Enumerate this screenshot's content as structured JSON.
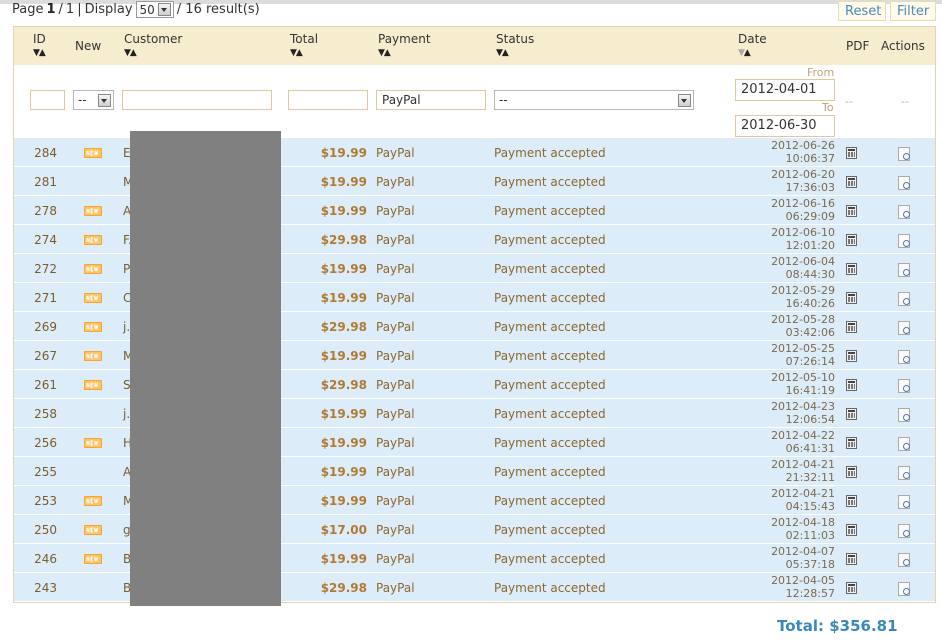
{
  "pagination": {
    "page_label": "Page",
    "current": "1",
    "sep": "/",
    "total_pages": "1",
    "pipe": "|",
    "display_label": "Display",
    "per_page": "50",
    "results": "/ 16 result(s)"
  },
  "buttons": {
    "reset": "Reset",
    "filter": "Filter"
  },
  "columns": {
    "id": "ID",
    "new": "New",
    "customer": "Customer",
    "total": "Total",
    "payment": "Payment",
    "status": "Status",
    "date": "Date",
    "pdf": "PDF",
    "actions": "Actions"
  },
  "filters": {
    "new_value": "--",
    "payment_value": "PayPal",
    "status_value": "--",
    "from_label": "From",
    "date_from": "2012-04-01",
    "to_label": "To",
    "date_to": "2012-06-30",
    "pdf_value": "--",
    "actions_value": "--"
  },
  "icons": {
    "new": "new-badge-icon",
    "pdf": "invoice-icon",
    "view": "view-details-icon"
  },
  "rows": [
    {
      "id": "284",
      "is_new": true,
      "customer": "E",
      "total": "$19.99",
      "payment": "PayPal",
      "status": "Payment accepted",
      "date": "2012-06-26",
      "time": "10:06:37"
    },
    {
      "id": "281",
      "is_new": false,
      "customer": "M",
      "total": "$19.99",
      "payment": "PayPal",
      "status": "Payment accepted",
      "date": "2012-06-20",
      "time": "17:36:03"
    },
    {
      "id": "278",
      "is_new": true,
      "customer": "A",
      "total": "$19.99",
      "payment": "PayPal",
      "status": "Payment accepted",
      "date": "2012-06-16",
      "time": "06:29:09"
    },
    {
      "id": "274",
      "is_new": true,
      "customer": "F.",
      "total": "$29.98",
      "payment": "PayPal",
      "status": "Payment accepted",
      "date": "2012-06-10",
      "time": "12:01:20"
    },
    {
      "id": "272",
      "is_new": true,
      "customer": "P",
      "total": "$19.99",
      "payment": "PayPal",
      "status": "Payment accepted",
      "date": "2012-06-04",
      "time": "08:44:30"
    },
    {
      "id": "271",
      "is_new": true,
      "customer": "C",
      "total": "$19.99",
      "payment": "PayPal",
      "status": "Payment accepted",
      "date": "2012-05-29",
      "time": "16:40:26"
    },
    {
      "id": "269",
      "is_new": true,
      "customer": "j.",
      "total": "$29.98",
      "payment": "PayPal",
      "status": "Payment accepted",
      "date": "2012-05-28",
      "time": "03:42:06"
    },
    {
      "id": "267",
      "is_new": true,
      "customer": "M",
      "total": "$19.99",
      "payment": "PayPal",
      "status": "Payment accepted",
      "date": "2012-05-25",
      "time": "07:26:14"
    },
    {
      "id": "261",
      "is_new": true,
      "customer": "S",
      "total": "$29.98",
      "payment": "PayPal",
      "status": "Payment accepted",
      "date": "2012-05-10",
      "time": "16:41:19"
    },
    {
      "id": "258",
      "is_new": false,
      "customer": "j.",
      "total": "$19.99",
      "payment": "PayPal",
      "status": "Payment accepted",
      "date": "2012-04-23",
      "time": "12:06:54"
    },
    {
      "id": "256",
      "is_new": true,
      "customer": "H",
      "total": "$19.99",
      "payment": "PayPal",
      "status": "Payment accepted",
      "date": "2012-04-22",
      "time": "06:41:31"
    },
    {
      "id": "255",
      "is_new": false,
      "customer": "A",
      "total": "$19.99",
      "payment": "PayPal",
      "status": "Payment accepted",
      "date": "2012-04-21",
      "time": "21:32:11"
    },
    {
      "id": "253",
      "is_new": true,
      "customer": "M",
      "total": "$19.99",
      "payment": "PayPal",
      "status": "Payment accepted",
      "date": "2012-04-21",
      "time": "04:15:43"
    },
    {
      "id": "250",
      "is_new": true,
      "customer": "g",
      "total": "$17.00",
      "payment": "PayPal",
      "status": "Payment accepted",
      "date": "2012-04-18",
      "time": "02:11:03"
    },
    {
      "id": "246",
      "is_new": true,
      "customer": "B",
      "total": "$19.99",
      "payment": "PayPal",
      "status": "Payment accepted",
      "date": "2012-04-07",
      "time": "05:37:18"
    },
    {
      "id": "243",
      "is_new": false,
      "customer": "B",
      "total": "$29.98",
      "payment": "PayPal",
      "status": "Payment accepted",
      "date": "2012-04-05",
      "time": "12:28:57"
    }
  ],
  "summary": {
    "grand_total": "Total: $356.81"
  },
  "colors": {
    "header_bg": "#f6ecce",
    "row_bg": "#ddecf9",
    "accent": "#3a88b8",
    "redaction": "#808080"
  }
}
